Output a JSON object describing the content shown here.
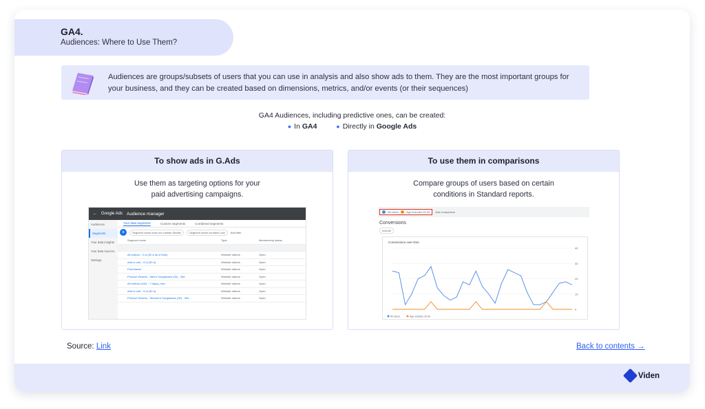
{
  "header": {
    "title": "GA4.",
    "subtitle": "Audiences: Where to Use Them?"
  },
  "info": {
    "text": "Audiences are groups/subsets of users that you can use in analysis and also show ads to them. They are the most important groups for your business, and they can be created based on dimensions, metrics, and/or events (or their sequences)",
    "icon": "book-icon"
  },
  "creation": {
    "lead": "GA4 Audiences, including predictive ones, can be created:",
    "option1_prefix": "In ",
    "option1_bold": "GA4",
    "option2_prefix": "Directly in ",
    "option2_bold": "Google Ads"
  },
  "panels": [
    {
      "title": "To show ads in G.Ads",
      "desc_line1": "Use them as targeting options for your",
      "desc_line2": "paid advertising campaigns."
    },
    {
      "title": "To use them in comparisons",
      "desc_line1": "Compare groups of users based on certain",
      "desc_line2": "conditions in Standard reports."
    }
  ],
  "gads_screenshot": {
    "brand": "Google Ads",
    "section": "Audience manager",
    "sidebar": [
      "Audiences",
      "Segments",
      "Your data insights",
      "Your data sources",
      "Settings"
    ],
    "tabs": [
      "Your data segments",
      "Custom segments",
      "Combined segments"
    ],
    "filters": [
      "Segment name does not contain Similar",
      "Segment name contains Last",
      "Add filter"
    ],
    "columns": [
      "Segment name",
      "Type",
      "Membership status"
    ],
    "rows": [
      [
        "All visitors - G.A (30 & all of time)",
        "Website visitors",
        "Open"
      ],
      [
        "Add to cart - G.A (30 d)",
        "Website visitors",
        "Open"
      ],
      [
        "Purchasers",
        "Website visitors",
        "Open"
      ],
      [
        "Product Viewers - Men's Sunglasses (30) - 30d",
        "Website visitors",
        "Open"
      ],
      [
        "All visitors (GA4 - 7 days)_new",
        "Website visitors",
        "Open"
      ],
      [
        "Add to cart - G.A (30 d)",
        "Website visitors",
        "Open"
      ],
      [
        "Product Viewers - Women's Sunglasses (30) - 30d",
        "Website visitors",
        "Open"
      ]
    ]
  },
  "ga_screenshot": {
    "chips": [
      "All Users",
      "Age includes 25-34",
      "Add comparison"
    ],
    "title": "Conversions",
    "include": "Include",
    "chart_title": "Conversions over time",
    "legend": [
      "All Users",
      "Age includes 25-34"
    ]
  },
  "chart_data": {
    "type": "line",
    "title": "Conversions over time",
    "x": [
      1,
      2,
      3,
      4,
      5,
      6,
      7,
      8,
      9,
      10,
      11,
      12,
      13,
      14,
      15,
      16,
      17,
      18,
      19,
      20,
      21,
      22,
      23,
      24,
      25,
      26,
      27,
      28,
      29,
      30,
      31
    ],
    "ylim": [
      0,
      40
    ],
    "y_ticks": [
      0,
      10,
      20,
      30,
      40
    ],
    "series": [
      {
        "name": "All Users",
        "color": "#4a86e8",
        "values": [
          25,
          24,
          3,
          10,
          20,
          22,
          28,
          14,
          9,
          6,
          8,
          18,
          16,
          25,
          15,
          10,
          4,
          17,
          26,
          24,
          22,
          11,
          3,
          3,
          5,
          11,
          17,
          18,
          16
        ]
      },
      {
        "name": "Age includes 25-34",
        "color": "#f08c26",
        "values": [
          0,
          0,
          0,
          0,
          0,
          0,
          5,
          0,
          0,
          0,
          0,
          0,
          0,
          5,
          0,
          0,
          0,
          0,
          0,
          0,
          0,
          0,
          0,
          0,
          5,
          0,
          0,
          0,
          0
        ]
      }
    ]
  },
  "footer": {
    "source_label": "Source:",
    "source_link": "Link",
    "back_link": "Back to contents →",
    "brand": "Viden"
  },
  "colors": {
    "accent_bg": "#e6e9fc",
    "pill_bg": "#dfe3fb",
    "link": "#2c5ef5",
    "brand_blue": "#1f3fd1"
  }
}
